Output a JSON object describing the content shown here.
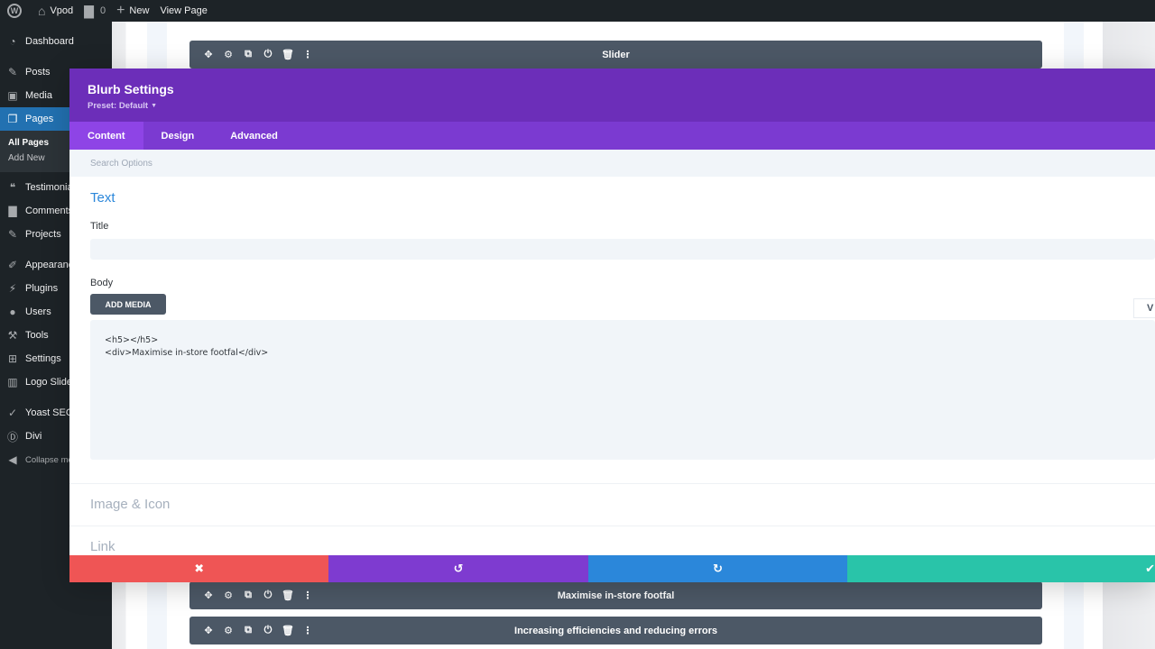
{
  "adminbar": {
    "wp_logo": "wordpress-icon",
    "site_name": "Vpod",
    "comments_count": "0",
    "new_label": "New",
    "view_page_label": "View Page"
  },
  "sidebar": {
    "items": [
      {
        "label": "Dashboard",
        "icon": "dashboard-icon"
      },
      {
        "label": "Posts",
        "icon": "pin-icon"
      },
      {
        "label": "Media",
        "icon": "media-icon"
      },
      {
        "label": "Pages",
        "icon": "pages-icon"
      },
      {
        "label": "Testimonials",
        "icon": "quote-icon"
      },
      {
        "label": "Comments",
        "icon": "comment-icon"
      },
      {
        "label": "Projects",
        "icon": "pin-icon"
      },
      {
        "label": "Appearance",
        "icon": "brush-icon"
      },
      {
        "label": "Plugins",
        "icon": "plugin-icon"
      },
      {
        "label": "Users",
        "icon": "user-icon"
      },
      {
        "label": "Tools",
        "icon": "wrench-icon"
      },
      {
        "label": "Settings",
        "icon": "settings-icon"
      },
      {
        "label": "Logo Slider",
        "icon": "slider-icon"
      },
      {
        "label": "Yoast SEO",
        "icon": "yoast-icon"
      },
      {
        "label": "Divi",
        "icon": "divi-icon"
      },
      {
        "label": "Collapse menu",
        "icon": "collapse-icon"
      }
    ],
    "submenu": [
      "All Pages",
      "Add New"
    ]
  },
  "canvas": {
    "modules": [
      {
        "label": "Slider"
      },
      {
        "label": "Maximise in-store footfal"
      },
      {
        "label": "Increasing efficiencies and reducing errors"
      }
    ]
  },
  "modal": {
    "title": "Blurb Settings",
    "preset": "Preset: Default",
    "tabs": [
      "Content",
      "Design",
      "Advanced"
    ],
    "search_placeholder": "Search Options",
    "section_text": "Text",
    "title_label": "Title",
    "title_value": "",
    "body_label": "Body",
    "add_media_label": "ADD MEDIA",
    "body_value": "<h5></h5>\n<div>Maximise in-store footfal</div>",
    "visual_tab_label": "V",
    "section_image_icon": "Image & Icon",
    "section_link": "Link"
  },
  "footer": {
    "cancel_icon": "✖",
    "undo_icon": "↺",
    "redo_icon": "↻",
    "save_icon": "✔"
  },
  "colors": {
    "header_purple": "#6c2eb9",
    "tabs_purple": "#7b3ad1",
    "cancel_red": "#ef5555",
    "redo_blue": "#2b87da",
    "save_green": "#29c4a9",
    "module_bar": "#4c5866"
  }
}
